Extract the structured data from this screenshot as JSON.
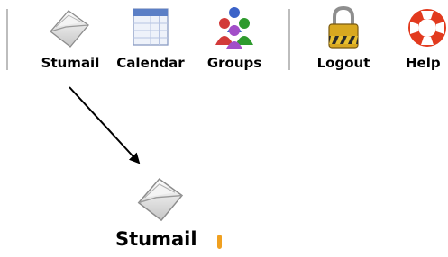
{
  "toolbar": {
    "items": [
      {
        "label": "Stumail",
        "icon": "envelope-icon"
      },
      {
        "label": "Calendar",
        "icon": "calendar-icon"
      },
      {
        "label": "Groups",
        "icon": "people-icon"
      },
      {
        "label": "Logout",
        "icon": "padlock-icon"
      },
      {
        "label": "Help",
        "icon": "lifebuoy-icon"
      }
    ]
  },
  "zoom": {
    "label": "Stumail",
    "icon": "envelope-icon"
  },
  "colors": {
    "separator": "#bdbdbd",
    "lifebuoy_red": "#e23a1e",
    "lock_gold": "#d8a820",
    "people_green": "#2e9a2e",
    "people_blue": "#3a62c8",
    "people_red": "#d23a3a",
    "calendar_blue": "#5b7fc6"
  }
}
